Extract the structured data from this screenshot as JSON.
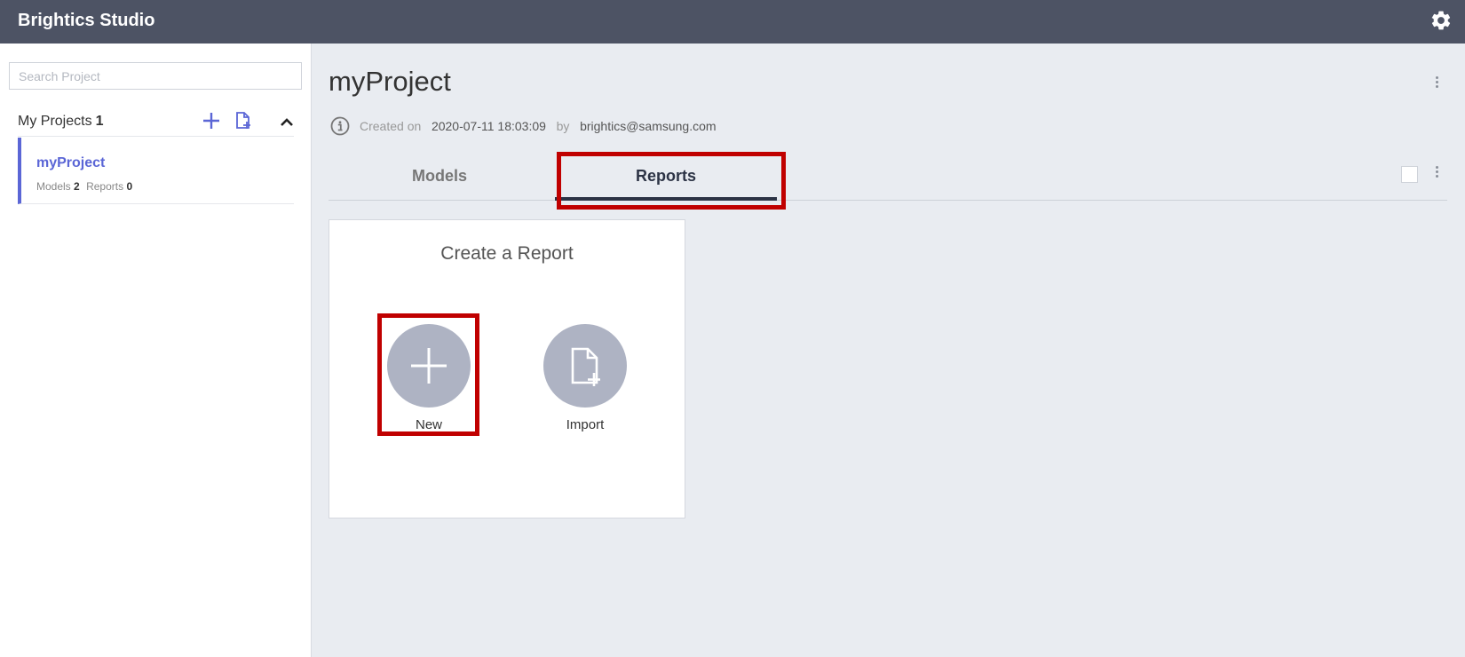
{
  "app": {
    "title": "Brightics Studio",
    "settings_icon": "gear-icon"
  },
  "sidebar": {
    "search_placeholder": "Search Project",
    "my_projects_label": "My Projects",
    "my_projects_count": "1",
    "add_icon": "plus-icon",
    "import_icon": "file-import-icon",
    "collapse_icon": "chevron-up-icon",
    "projects": [
      {
        "name": "myProject",
        "models_label": "Models",
        "models_count": "2",
        "reports_label": "Reports",
        "reports_count": "0"
      }
    ]
  },
  "main": {
    "title": "myProject",
    "info": {
      "created_label": "Created on",
      "created_value": "2020-07-11 18:03:09",
      "by_label": "by",
      "by_value": "brightics@samsung.com"
    },
    "tabs": [
      {
        "label": "Models",
        "active": false
      },
      {
        "label": "Reports",
        "active": true
      }
    ],
    "card": {
      "title": "Create a Report",
      "new_label": "New",
      "import_label": "Import"
    }
  },
  "colors": {
    "topbar": "#4d5364",
    "accent": "#5b66d6",
    "highlight": "#c00000",
    "active_tab": "#2c3345",
    "circle": "#aeb3c3"
  }
}
